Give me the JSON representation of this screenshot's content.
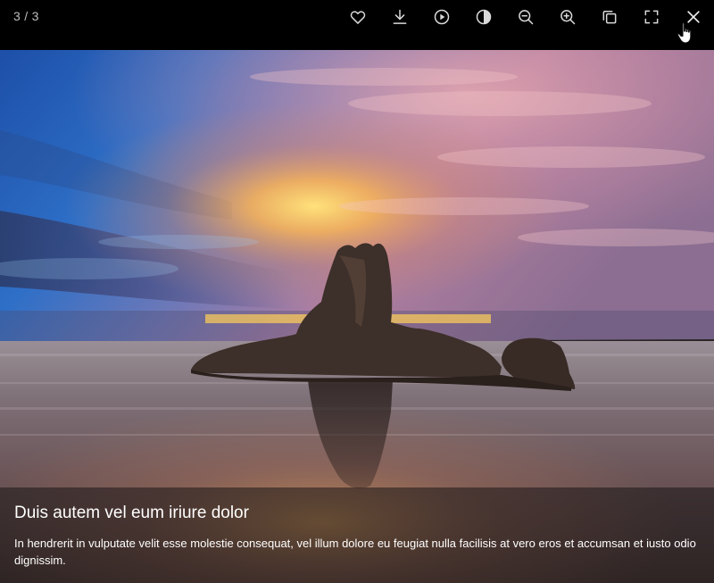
{
  "toolbar": {
    "counter": "3 / 3",
    "icons": [
      "heart-icon",
      "download-icon",
      "play-icon",
      "contrast-icon",
      "zoom-out-icon",
      "zoom-in-icon",
      "copy-icon",
      "fullscreen-icon",
      "close-icon"
    ],
    "icon_color": "#d9d9d9"
  },
  "caption": {
    "title": "Duis autem vel eum iriure dolor",
    "text": "In hendrerit in vulputate velit esse molestie consequat, vel illum dolore eu feugiat nulla facilisis at vero eros et accumsan et iusto odio dignissim."
  }
}
